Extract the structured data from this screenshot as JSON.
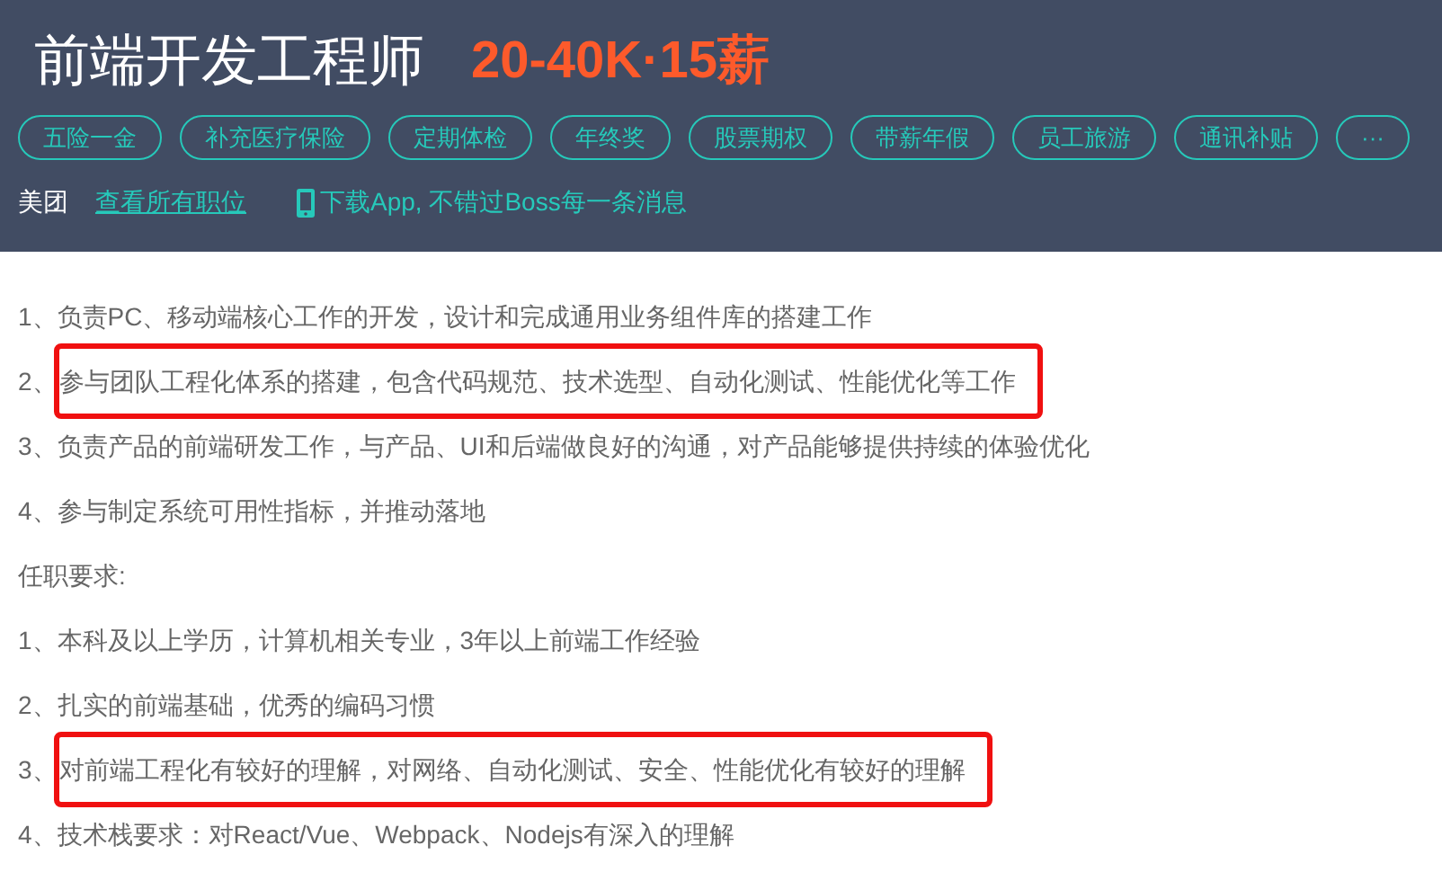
{
  "header": {
    "title": "前端开发工程师",
    "salary": "20-40K·15薪",
    "benefits": [
      "五险一金",
      "补充医疗保险",
      "定期体检",
      "年终奖",
      "股票期权",
      "带薪年假",
      "员工旅游",
      "通讯补贴",
      "···"
    ],
    "company": "美团",
    "all_jobs_link": "查看所有职位",
    "app_promo": "下载App, 不错过Boss每一条消息"
  },
  "description": [
    {
      "kind": "item",
      "number": "1、",
      "text": "负责PC、移动端核心工作的开发，设计和完成通用业务组件库的搭建工作",
      "highlighted": false
    },
    {
      "kind": "item",
      "number": "2、",
      "text": "参与团队工程化体系的搭建，包含代码规范、技术选型、自动化测试、性能优化等工作",
      "highlighted": true
    },
    {
      "kind": "item",
      "number": "3、",
      "text": "负责产品的前端研发工作，与产品、UI和后端做良好的沟通，对产品能够提供持续的体验优化",
      "highlighted": false
    },
    {
      "kind": "item",
      "number": "4、",
      "text": "参与制定系统可用性指标，并推动落地",
      "highlighted": false
    },
    {
      "kind": "heading",
      "text": "任职要求:"
    },
    {
      "kind": "item",
      "number": "1、",
      "text": "本科及以上学历，计算机相关专业，3年以上前端工作经验",
      "highlighted": false
    },
    {
      "kind": "item",
      "number": "2、",
      "text": "扎实的前端基础，优秀的编码习惯",
      "highlighted": false
    },
    {
      "kind": "item",
      "number": "3、",
      "text": "对前端工程化有较好的理解，对网络、自动化测试、安全、性能优化有较好的理解",
      "highlighted": true
    },
    {
      "kind": "item",
      "number": "4、",
      "text": "技术栈要求：对React/Vue、Webpack、Nodejs有深入的理解",
      "highlighted": false
    }
  ]
}
